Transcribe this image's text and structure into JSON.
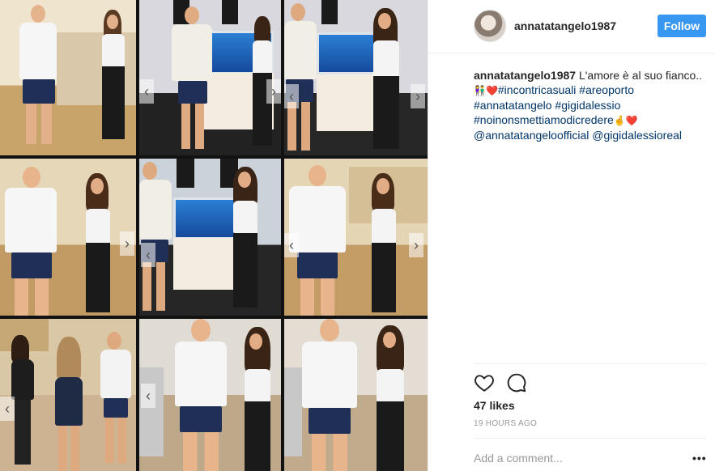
{
  "post": {
    "username": "annatatangelo1987",
    "follow_label": "Follow",
    "caption_text": "L'amore è al suo fianco..",
    "hashtags_line1": "#incontricasuali #areoporto",
    "hashtags_line2": "#annatatangelo #gigidalessio",
    "hashtags_line3": "#noinonsmettiamodicredere",
    "mentions": "@annatatangeloofficial @gigidalessioreal",
    "likes": "47 likes",
    "timestamp": "19 HOURS AGO",
    "comment_placeholder": "Add a comment...",
    "more_options": "•••"
  },
  "icons": {
    "heart": "heart-icon",
    "comment": "comment-icon",
    "emoji_couple": "couple-emoji",
    "emoji_hands": "hands-emoji"
  },
  "colors": {
    "follow_button": "#3897f0",
    "hashtag": "#003569",
    "photo_border": "#121212"
  }
}
